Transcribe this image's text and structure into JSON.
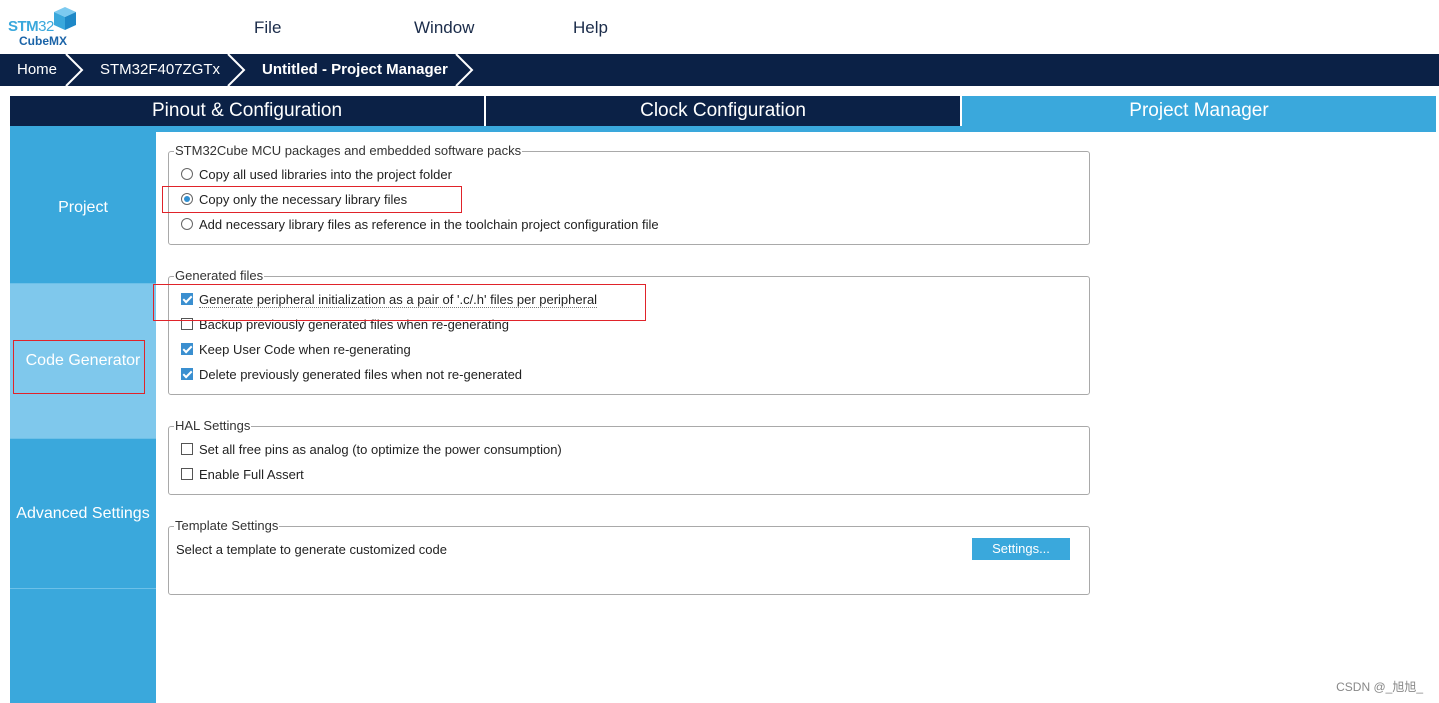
{
  "logo": {
    "brand_top": "STM",
    "brand_num": "32",
    "brand_bottom": "CubeMX"
  },
  "menu": [
    "File",
    "Window",
    "Help"
  ],
  "breadcrumb": [
    "Home",
    "STM32F407ZGTx",
    "Untitled - Project Manager"
  ],
  "tabs": [
    {
      "label": "Pinout & Configuration",
      "active": false
    },
    {
      "label": "Clock Configuration",
      "active": false
    },
    {
      "label": "Project Manager",
      "active": true
    }
  ],
  "sidebar": [
    {
      "label": "Project",
      "active": false
    },
    {
      "label": "Code Generator",
      "active": true
    },
    {
      "label": "Advanced Settings",
      "active": false
    }
  ],
  "packages": {
    "title": "STM32Cube MCU packages and embedded software packs",
    "options": [
      {
        "label": "Copy all used libraries into the project folder",
        "selected": false
      },
      {
        "label": "Copy only the necessary library files",
        "selected": true
      },
      {
        "label": "Add necessary library files as reference in the toolchain project configuration file",
        "selected": false
      }
    ]
  },
  "generated": {
    "title": "Generated files",
    "options": [
      {
        "label": "Generate peripheral initialization as a pair of '.c/.h' files per peripheral",
        "checked": true
      },
      {
        "label": "Backup previously generated files when re-generating",
        "checked": false
      },
      {
        "label": "Keep User Code when re-generating",
        "checked": true
      },
      {
        "label": "Delete previously generated files when not re-generated",
        "checked": true
      }
    ]
  },
  "hal": {
    "title": "HAL Settings",
    "options": [
      {
        "label": "Set all free pins as analog (to optimize the power consumption)",
        "checked": false
      },
      {
        "label": "Enable Full Assert",
        "checked": false
      }
    ]
  },
  "template": {
    "title": "Template Settings",
    "text": "Select a template to generate customized code",
    "button": "Settings..."
  },
  "watermark": "CSDN @_旭旭_",
  "colors": {
    "navy": "#0b2146",
    "accent": "#3aa8dc",
    "sidebar_active": "#7fc8ec",
    "highlight": "#e0232a"
  }
}
